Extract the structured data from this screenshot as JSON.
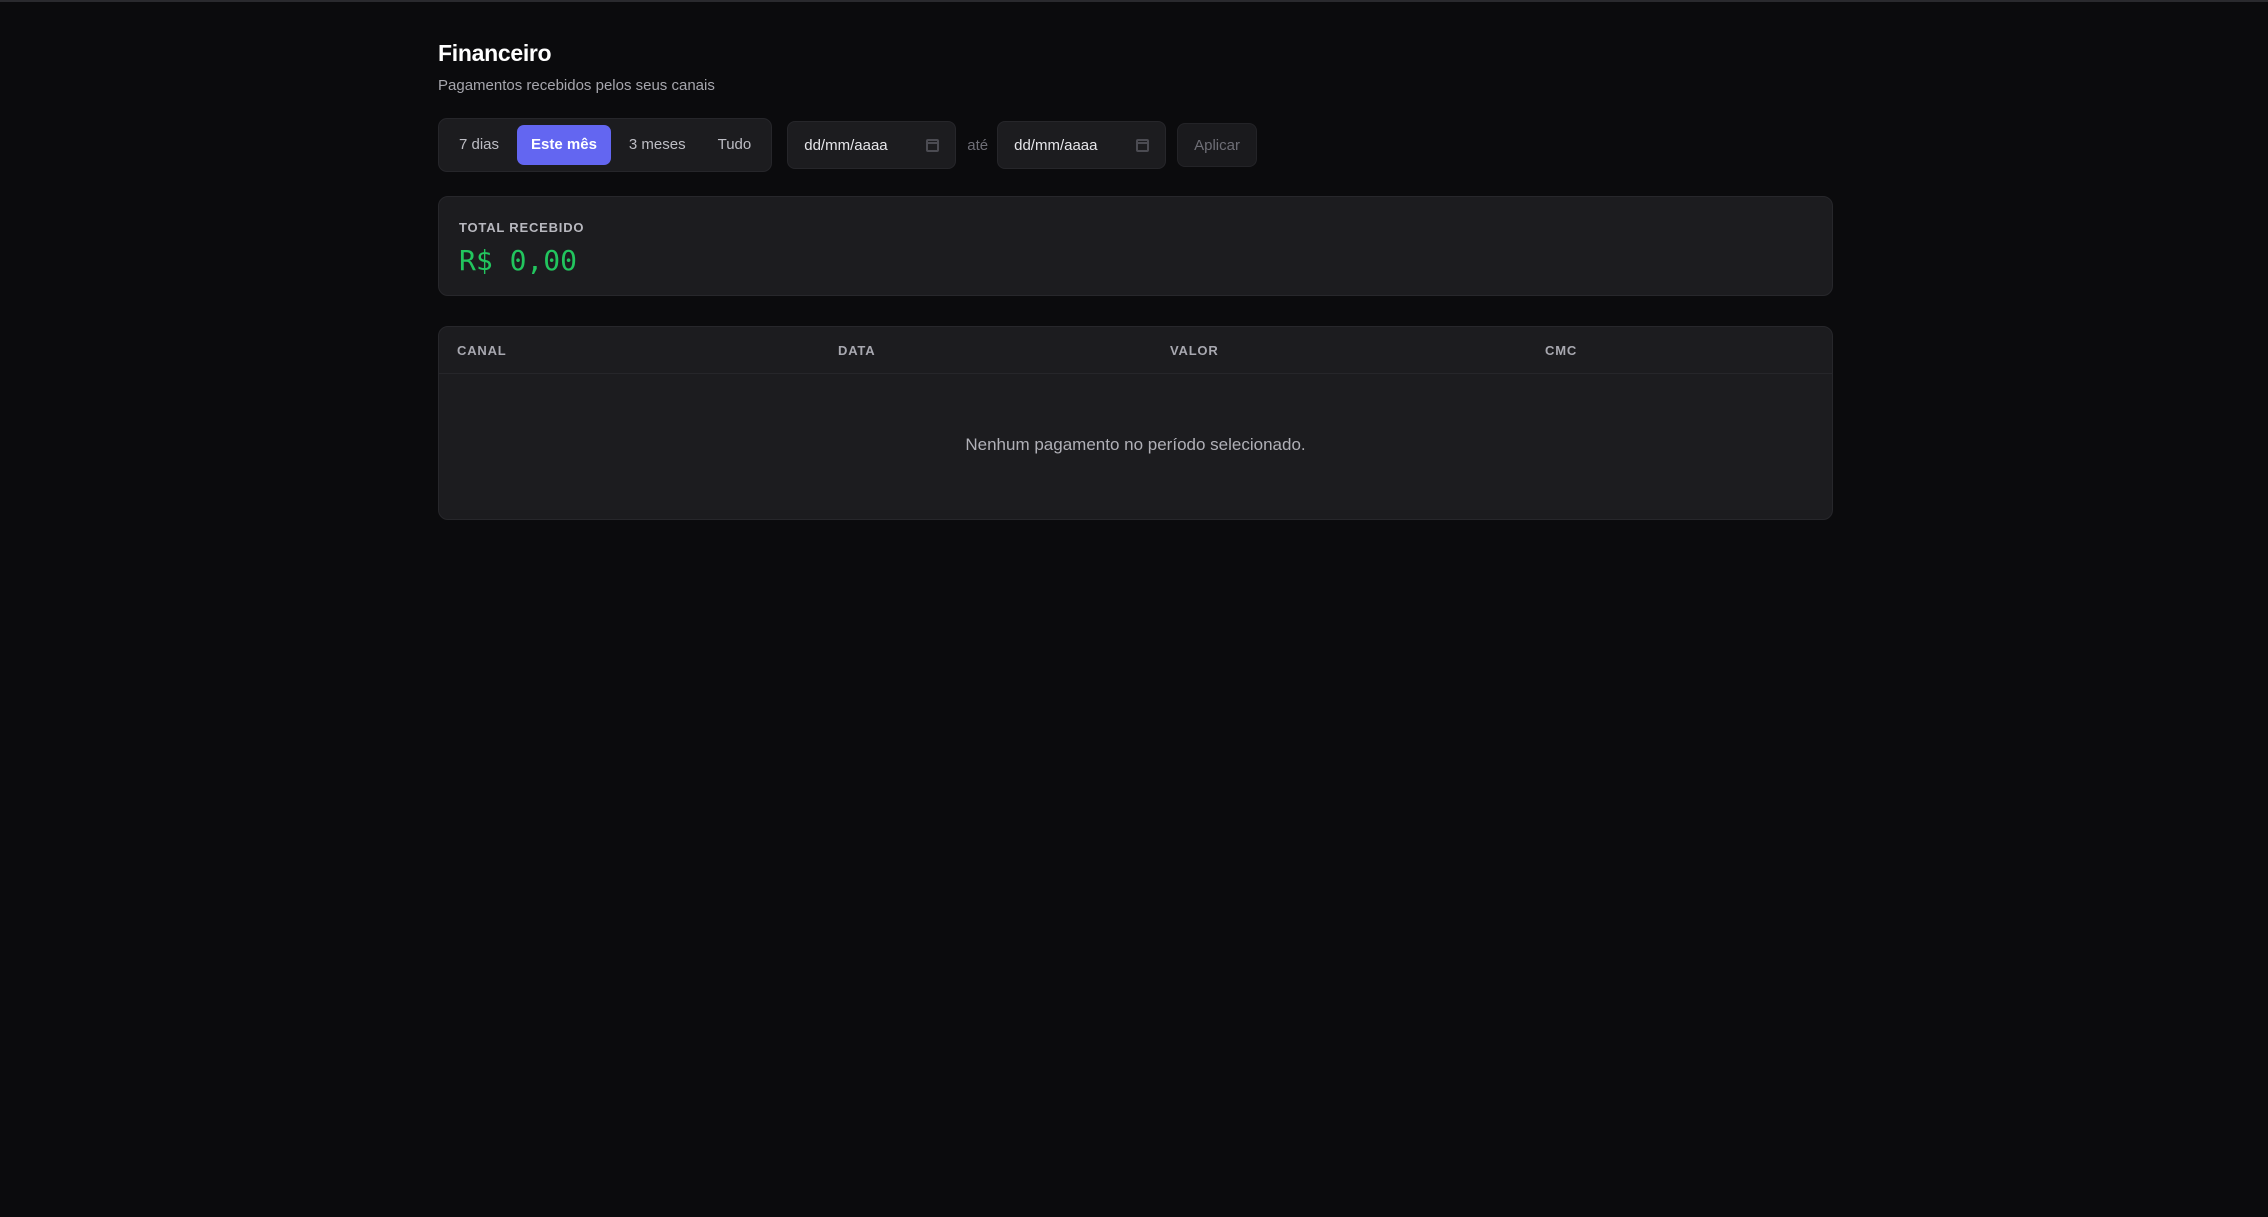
{
  "header": {
    "title": "Financeiro",
    "subtitle": "Pagamentos recebidos pelos seus canais"
  },
  "filters": {
    "ranges": [
      "7 dias",
      "Este mês",
      "3 meses",
      "Tudo"
    ],
    "active_range": "Este mês",
    "date_from_placeholder": "dd/mm/aaaa",
    "date_to_placeholder": "dd/mm/aaaa",
    "separator": "até",
    "apply_label": "Aplicar"
  },
  "summary": {
    "label": "TOTAL RECEBIDO",
    "value": "R$ 0,00"
  },
  "table": {
    "columns": [
      "CANAL",
      "DATA",
      "VALOR",
      "CMC"
    ],
    "rows": [],
    "empty_message": "Nenhum pagamento no período selecionado."
  },
  "colors": {
    "background": "#0b0b0d",
    "card": "#1c1c1f",
    "accent": "#6366f1",
    "positive": "#22c55e"
  },
  "icons": [
    "calendar-icon"
  ]
}
